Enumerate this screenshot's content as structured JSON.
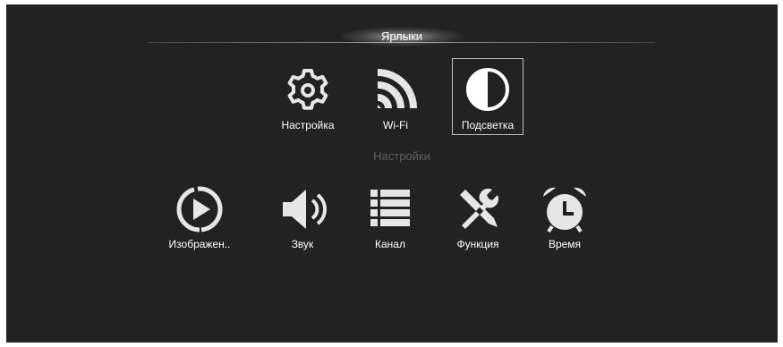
{
  "header": {
    "title": "Ярлыки"
  },
  "shortcuts": [
    {
      "label": "Настройка",
      "icon": "gear-icon"
    },
    {
      "label": "Wi-Fi",
      "icon": "wifi-icon"
    },
    {
      "label": "Подсветка",
      "icon": "backlight-icon",
      "selected": true
    }
  ],
  "settings_section": {
    "label": "Настройки"
  },
  "settings": [
    {
      "label": "Изображен..",
      "icon": "play-circle-icon"
    },
    {
      "label": "Звук",
      "icon": "speaker-icon"
    },
    {
      "label": "Канал",
      "icon": "list-icon"
    },
    {
      "label": "Функция",
      "icon": "tools-icon"
    },
    {
      "label": "Время",
      "icon": "alarm-clock-icon"
    }
  ],
  "colors": {
    "background": "#222222",
    "icon": "#e6e6e6",
    "section_label": "#5f5f5f",
    "selection_border": "#bdbdbd"
  }
}
